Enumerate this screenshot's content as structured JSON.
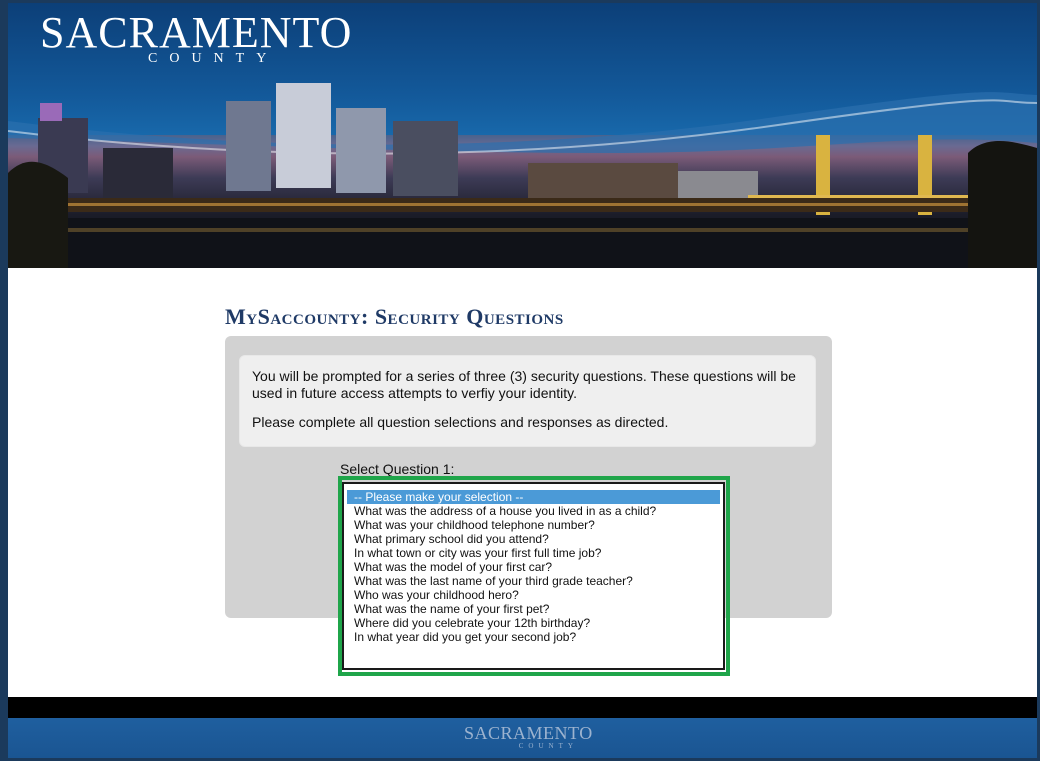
{
  "header": {
    "logo_main": "SACRAMENTO",
    "logo_sub": "COUNTY"
  },
  "page": {
    "title": "MySaccounty: Security Questions"
  },
  "info": {
    "paragraph1": "You will be prompted for a series of three (3) security questions. These questions will be used in future access attempts to verfiy your identity.",
    "paragraph2": "Please complete all question selections and responses as directed."
  },
  "question1": {
    "label": "Select Question 1:",
    "options": [
      "-- Please make your selection --",
      "What was the address of a house you lived in as a child?",
      "What was your childhood telephone number?",
      "What primary school did you attend?",
      "In what town or city was your first full time job?",
      "What was the model of your first car?",
      "What was the last name of your third grade teacher?",
      "Who was your childhood hero?",
      "What was the name of your first pet?",
      "Where did you celebrate your 12th birthday?",
      "In what year did you get your second job?"
    ],
    "selected_index": 0
  },
  "footer": {
    "logo_main": "SACRAMENTO",
    "logo_sub": "COUNTY"
  },
  "colors": {
    "title": "#1f3a66",
    "highlight": "#1fa54a",
    "selected_option": "#4b9ad7",
    "footer_blue": "#1a5592"
  }
}
